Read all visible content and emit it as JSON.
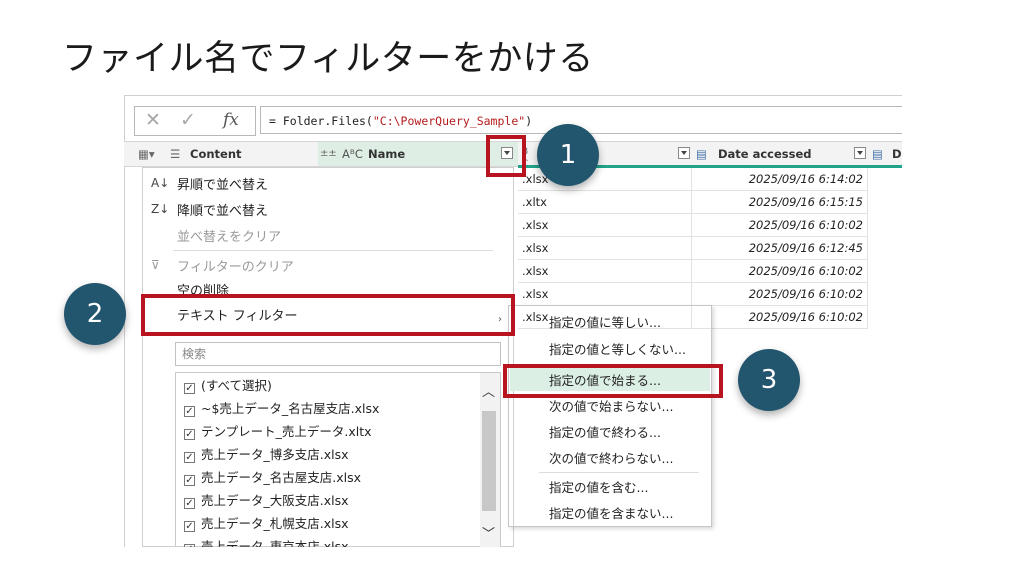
{
  "slide": {
    "title": "ファイル名でフィルターをかける"
  },
  "formula_bar": {
    "prefix": "= Folder.Files(",
    "argument": "\"C:\\PowerQuery_Sample\"",
    "suffix": ")"
  },
  "columns": {
    "content": "Content",
    "name": "Name",
    "name_type_glyph": "AᴮC",
    "date_accessed": "Date accessed",
    "cut_off_next": "D"
  },
  "rows": [
    {
      "extension": ".xlsx",
      "date_accessed": "2025/09/16 6:14:02"
    },
    {
      "extension": ".xltx",
      "date_accessed": "2025/09/16 6:15:15"
    },
    {
      "extension": ".xlsx",
      "date_accessed": "2025/09/16 6:10:02"
    },
    {
      "extension": ".xlsx",
      "date_accessed": "2025/09/16 6:12:45"
    },
    {
      "extension": ".xlsx",
      "date_accessed": "2025/09/16 6:10:02"
    },
    {
      "extension": ".xlsx",
      "date_accessed": "2025/09/16 6:10:02"
    },
    {
      "extension": ".xlsx",
      "date_accessed": "2025/09/16 6:10:02"
    }
  ],
  "filter_menu": {
    "sort_ascending": "昇順で並べ替え",
    "sort_descending": "降順で並べ替え",
    "clear_sort": "並べ替えをクリア",
    "clear_filter": "フィルターのクリア",
    "remove_empty": "空の削除",
    "text_filters": "テキスト フィルター",
    "search_placeholder": "検索",
    "items": [
      "(すべて選択)",
      "~$売上データ_名古屋支店.xlsx",
      "テンプレート_売上データ.xltx",
      "売上データ_博多支店.xlsx",
      "売上データ_名古屋支店.xlsx",
      "売上データ_大阪支店.xlsx",
      "売上データ_札幌支店.xlsx",
      "売上データ_東京本店.xlsx"
    ]
  },
  "text_filter_submenu": [
    "指定の値に等しい...",
    "指定の値と等しくない...",
    "指定の値で始まる...",
    "次の値で始まらない...",
    "指定の値で終わる...",
    "次の値で終わらない...",
    "指定の値を含む...",
    "指定の値を含まない..."
  ],
  "callouts": [
    "1",
    "2",
    "3"
  ],
  "colors": {
    "callout_circle": "#22556e",
    "highlight_border": "#b8141f",
    "accent_line": "#20a389"
  }
}
